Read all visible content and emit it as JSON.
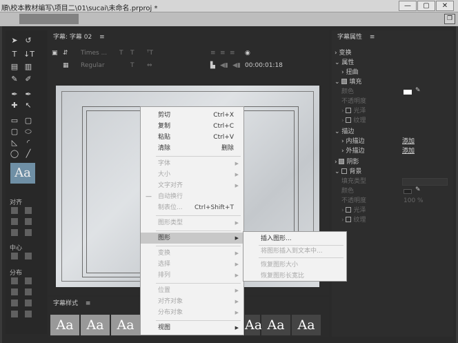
{
  "window": {
    "title": "順\\校本教材编写\\项目二\\01\\sucai\\未命名.prproj *",
    "min": "—",
    "max": "▢",
    "close": "✕"
  },
  "menubar": {
    "restore": "❐"
  },
  "title_panel": {
    "label": "字幕: 字幕 02",
    "menu": "≡",
    "font_family": "Times ...",
    "font_style": "Regular",
    "timecode": "00:00:01:18"
  },
  "tools": {
    "sections": {
      "align": "对齐",
      "center": "中心",
      "distribute": "分布"
    },
    "aa": "Aa"
  },
  "context_menu": {
    "items": [
      {
        "label": "剪切",
        "key": "Ctrl+X"
      },
      {
        "label": "复制",
        "key": "Ctrl+C"
      },
      {
        "label": "粘贴",
        "key": "Ctrl+V"
      },
      {
        "label": "清除",
        "key": "删除"
      },
      {
        "label": "字体"
      },
      {
        "label": "大小"
      },
      {
        "label": "文字对齐"
      },
      {
        "label": "自动换行"
      },
      {
        "label": "制表位...",
        "key": "Ctrl+Shift+T"
      },
      {
        "label": "图形类型"
      },
      {
        "label": "图形"
      },
      {
        "label": "变换"
      },
      {
        "label": "选择"
      },
      {
        "label": "排列"
      },
      {
        "label": "位置"
      },
      {
        "label": "对齐对象"
      },
      {
        "label": "分布对象"
      },
      {
        "label": "视图"
      }
    ],
    "submenu": [
      "插入图形...",
      "将图形插入到文本中...",
      "恢复图形大小",
      "恢复图形长宽比"
    ]
  },
  "styles_panel": {
    "label": "字幕样式",
    "menu": "≡",
    "swatch": "Aa"
  },
  "properties": {
    "header": "字幕属性",
    "menu": "≡",
    "rows": [
      "变换",
      "属性",
      "扭曲",
      "填充",
      "颜色",
      "不透明度",
      "光泽",
      "纹理",
      "描边",
      "内描边",
      "外描边",
      "阴影",
      "背景",
      "填充类型",
      "颜色",
      "不透明度",
      "光泽",
      "纹理"
    ],
    "add": "添加",
    "bg_opacity": "100 %"
  }
}
